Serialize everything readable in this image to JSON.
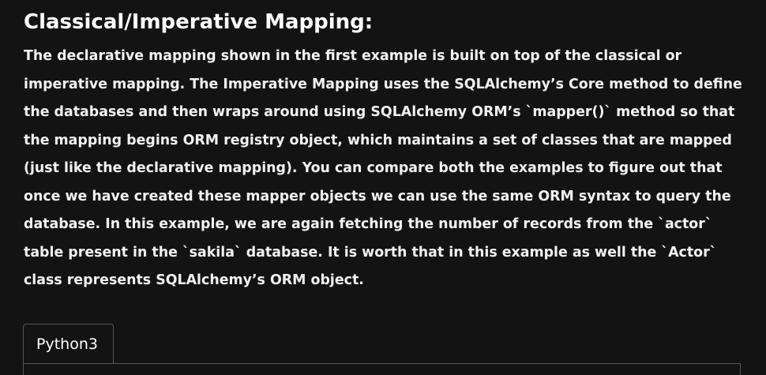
{
  "article": {
    "heading": "Classical/Imperative Mapping:",
    "paragraph": "The declarative mapping shown in the first example is built on top of the classical or imperative mapping.  The Imperative Mapping uses the SQLAlchemy’s Core method to define the databases and then wraps around using SQLAlchemy ORM’s `mapper()` method so that the mapping begins ORM registry object, which maintains a set of classes that are mapped (just like the declarative mapping). You can compare both the examples to figure out that once we have created these mapper objects we can use the same ORM syntax to query the database. In this example, we are again fetching the number of records from the `actor` table present in the `sakila` database. It is worth that in this example as well the `Actor` class represents SQLAlchemy’s ORM object."
  },
  "code_block": {
    "tabs": [
      {
        "label": "Python3",
        "active": true
      }
    ]
  },
  "colors": {
    "background": "#131313",
    "text": "#f2f2f2",
    "border": "#555555"
  }
}
